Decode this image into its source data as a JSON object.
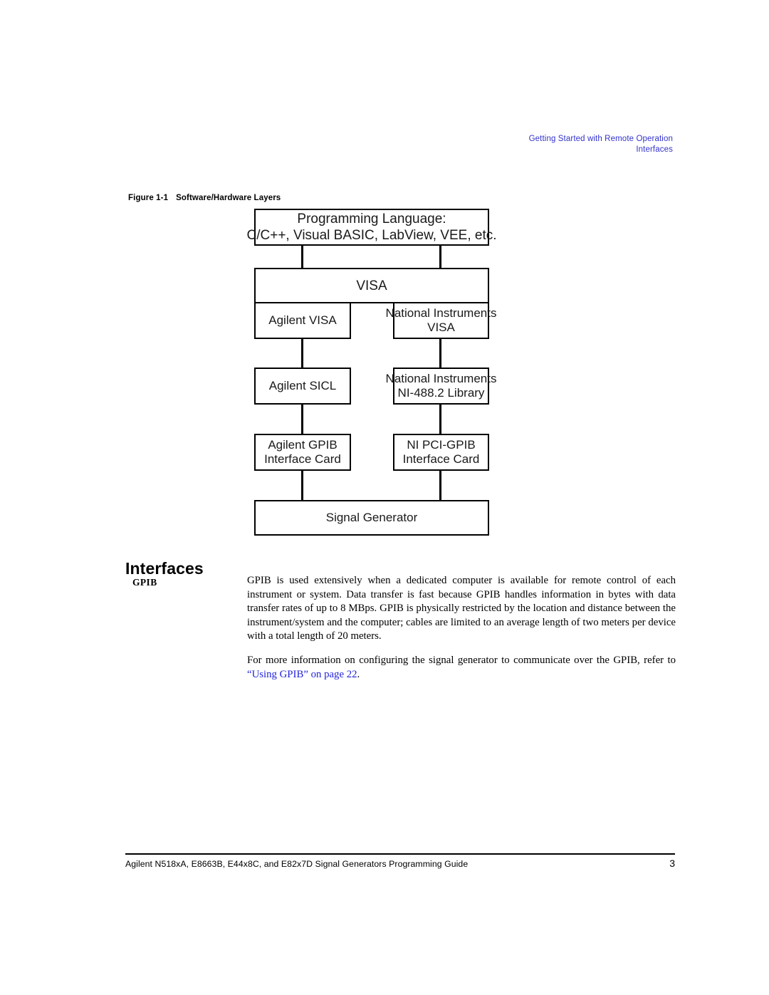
{
  "page": {
    "running_header": [
      "Getting Started with Remote Operation",
      "Interfaces"
    ],
    "header_color": "#3333cc"
  },
  "figure": {
    "caption_number": "Figure 1-1",
    "caption_title": "Software/Hardware Layers",
    "boxes": {
      "programming_language_line1": "Programming Language:",
      "programming_language_line2": "C/C++, Visual BASIC, LabView, VEE, etc.",
      "visa": "VISA",
      "agilent_visa": "Agilent VISA",
      "ni_visa_line1": "National Instruments",
      "ni_visa_line2": "VISA",
      "agilent_sicl": "Agilent SICL",
      "ni_488_line1": "National Instruments",
      "ni_488_line2": "NI-488.2 Library",
      "agilent_gpib_line1": "Agilent GPIB",
      "agilent_gpib_line2": "Interface Card",
      "ni_pci_gpib_line1": "NI PCI-GPIB",
      "ni_pci_gpib_line2": "Interface Card",
      "signal_generator": "Signal Generator"
    }
  },
  "section": {
    "heading": "Interfaces",
    "gpib": {
      "label": "GPIB",
      "paragraph_1": "GPIB is used extensively when a dedicated computer is available for remote control of each instrument or system. Data transfer is fast because GPIB handles information in bytes with data transfer rates of up to 8 MBps. GPIB is physically restricted by the location and distance between the instrument/system and the computer; cables are limited to an average length of two meters per device with a total length of 20 meters.",
      "paragraph_2_before_link": "For more information on configuring the signal generator to communicate over the GPIB, refer to ",
      "paragraph_2_link": "“Using GPIB” on page 22",
      "paragraph_2_after_link": ".",
      "link_color": "#2222dd"
    }
  },
  "footer": {
    "text": "Agilent N518xA, E8663B, E44x8C, and E82x7D Signal Generators Programming Guide",
    "page_number": "3"
  }
}
